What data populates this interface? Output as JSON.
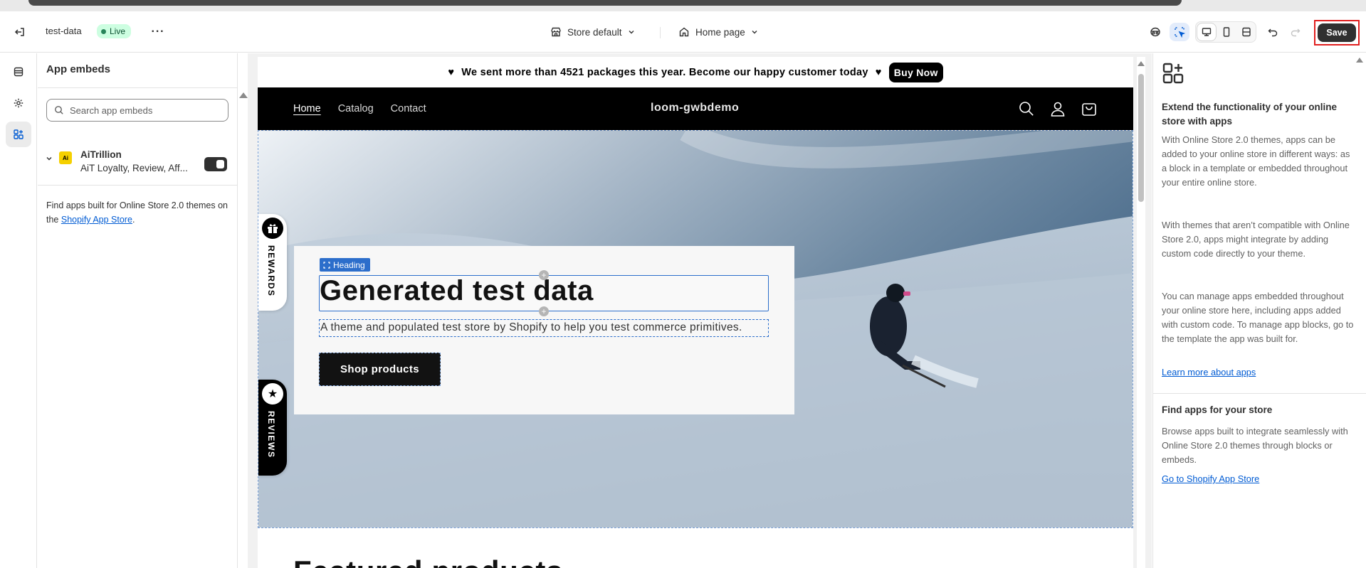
{
  "topbar": {
    "store_name": "test-data",
    "status": "Live",
    "theme_selector": "Store default",
    "page_selector": "Home page",
    "save_label": "Save"
  },
  "panel": {
    "title": "App embeds",
    "search_placeholder": "Search app embeds",
    "apps": [
      {
        "name": "AiTrillion",
        "subtitle": "AiT Loyalty, Review, Aff...",
        "logo_text": "Ai",
        "enabled": true
      }
    ],
    "note_prefix": "Find apps built for Online Store 2.0 themes on the ",
    "note_link": "Shopify App Store",
    "note_suffix": "."
  },
  "preview": {
    "announcement": "We sent more than 4521 packages this year. Become our happy customer today",
    "announcement_heart": "♥",
    "buy_now": "Buy Now",
    "nav": [
      "Home",
      "Catalog",
      "Contact"
    ],
    "store_logo": "loom-gwbdemo",
    "heading_tag": "Heading",
    "hero_title": "Generated test data",
    "hero_subtitle": "A theme and populated test store by Shopify to help you test commerce primitives.",
    "hero_button": "Shop products",
    "rewards_tab": "REWARDS",
    "reviews_tab": "REVIEWS",
    "featured_title": "Featured products"
  },
  "info": {
    "heading": "Extend the functionality of your online store with apps",
    "p1": "With Online Store 2.0 themes, apps can be added to your online store in different ways: as a block in a template or embedded throughout your entire online store.",
    "p2": "With themes that aren’t compatible with Online Store 2.0, apps might integrate by adding custom code directly to your theme.",
    "p3": "You can manage apps embedded throughout your online store here, including apps added with custom code. To manage app blocks, go to the template the app was built for.",
    "link1": "Learn more about apps",
    "heading2": "Find apps for your store",
    "p4": "Browse apps built to integrate seamlessly with Online Store 2.0 themes through blocks or embeds.",
    "link2": "Go to Shopify App Store"
  },
  "colors": {
    "accent_blue": "#2c6ecb",
    "live_badge": "#cdfee1",
    "save_highlight": "#e01e1e"
  }
}
